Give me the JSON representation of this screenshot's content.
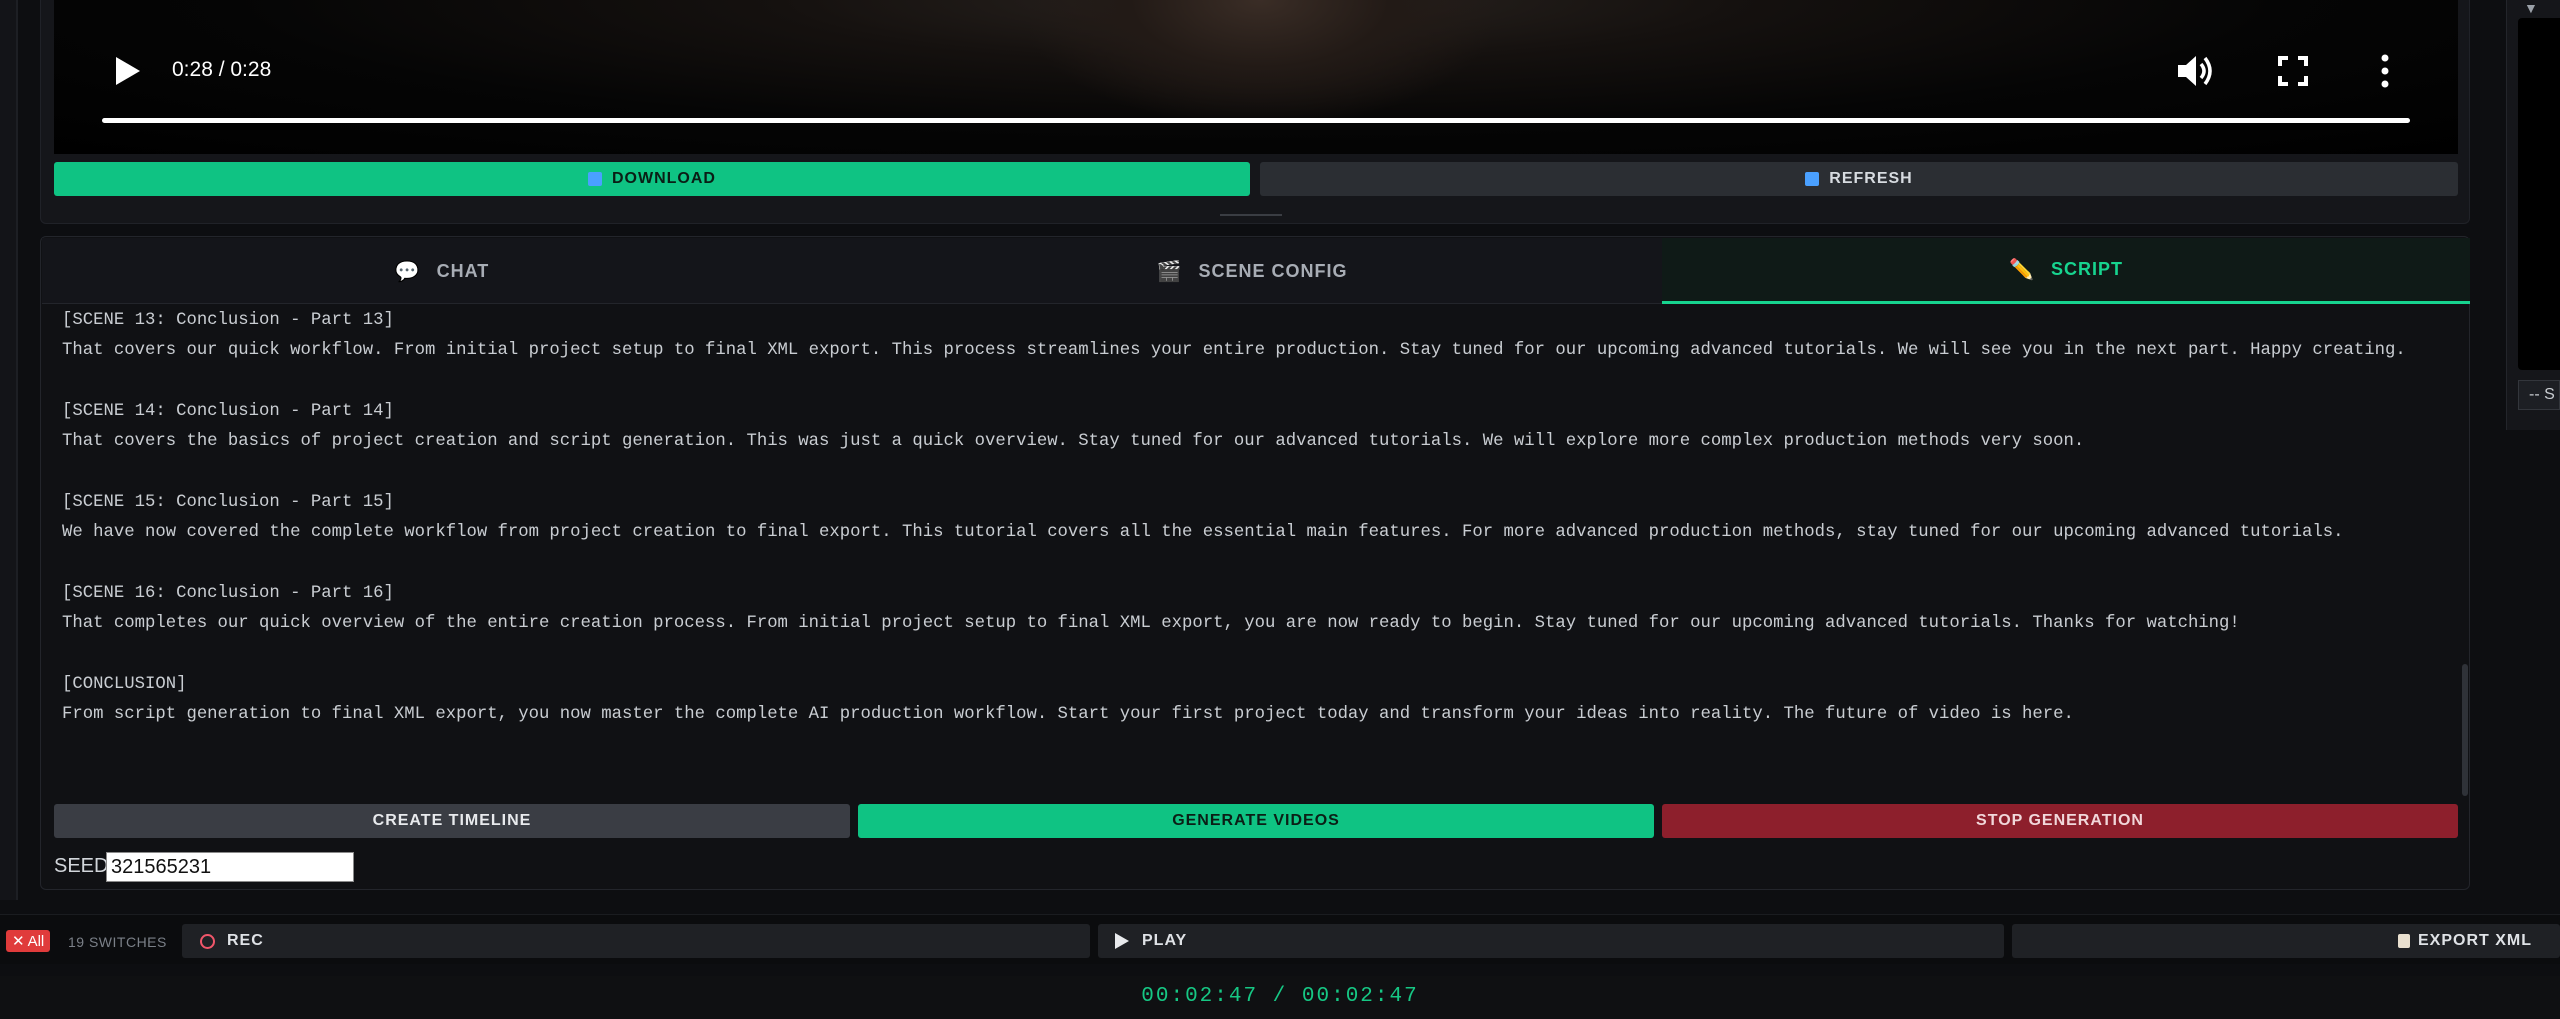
{
  "video": {
    "time": "0:28 / 0:28",
    "progress": 1.0
  },
  "actions": {
    "download_label": "DOWNLOAD",
    "refresh_label": "REFRESH"
  },
  "tabs": [
    {
      "label": "CHAT",
      "icon": "speech-bubble-icon"
    },
    {
      "label": "SCENE CONFIG",
      "icon": "clapperboard-icon"
    },
    {
      "label": "SCRIPT",
      "icon": "pencil-icon",
      "active": true
    }
  ],
  "script_lines": [
    "[SCENE 13: Conclusion - Part 13]",
    "That covers our quick workflow. From initial project setup to final XML export. This process streamlines your entire production. Stay tuned for our upcoming advanced tutorials. We will see you in the next part. Happy creating.",
    "",
    "[SCENE 14: Conclusion - Part 14]",
    "That covers the basics of project creation and script generation. This was just a quick overview. Stay tuned for our advanced tutorials. We will explore more complex production methods very soon.",
    "",
    "[SCENE 15: Conclusion - Part 15]",
    "We have now covered the complete workflow from project creation to final export. This tutorial covers all the essential main features. For more advanced production methods, stay tuned for our upcoming advanced tutorials.",
    "",
    "[SCENE 16: Conclusion - Part 16]",
    "That completes our quick overview of the entire creation process. From initial project setup to final XML export, you are now ready to begin. Stay tuned for our upcoming advanced tutorials. Thanks for watching!",
    "",
    "[CONCLUSION]",
    "From script generation to final XML export, you now master the complete AI production workflow. Start your first project today and transform your ideas into reality. The future of video is here."
  ],
  "generation": {
    "create_timeline_label": "CREATE TIMELINE",
    "generate_videos_label": "GENERATE VIDEOS",
    "stop_generation_label": "STOP GENERATION",
    "seed_label": "SEED",
    "seed_value": "321565231"
  },
  "side_panel": {
    "select_value": "-- S"
  },
  "bottom_bar": {
    "all_label": "All",
    "switch_count": "19 SWITCHES",
    "rec_label": "REC",
    "play_label": "PLAY",
    "export_label": "EXPORT XML",
    "timecode": "00:02:47 / 00:02:47"
  },
  "colors": {
    "accent_green": "#0fc383",
    "danger_red": "#8d1f2c",
    "timecode_green": "#16c784"
  }
}
